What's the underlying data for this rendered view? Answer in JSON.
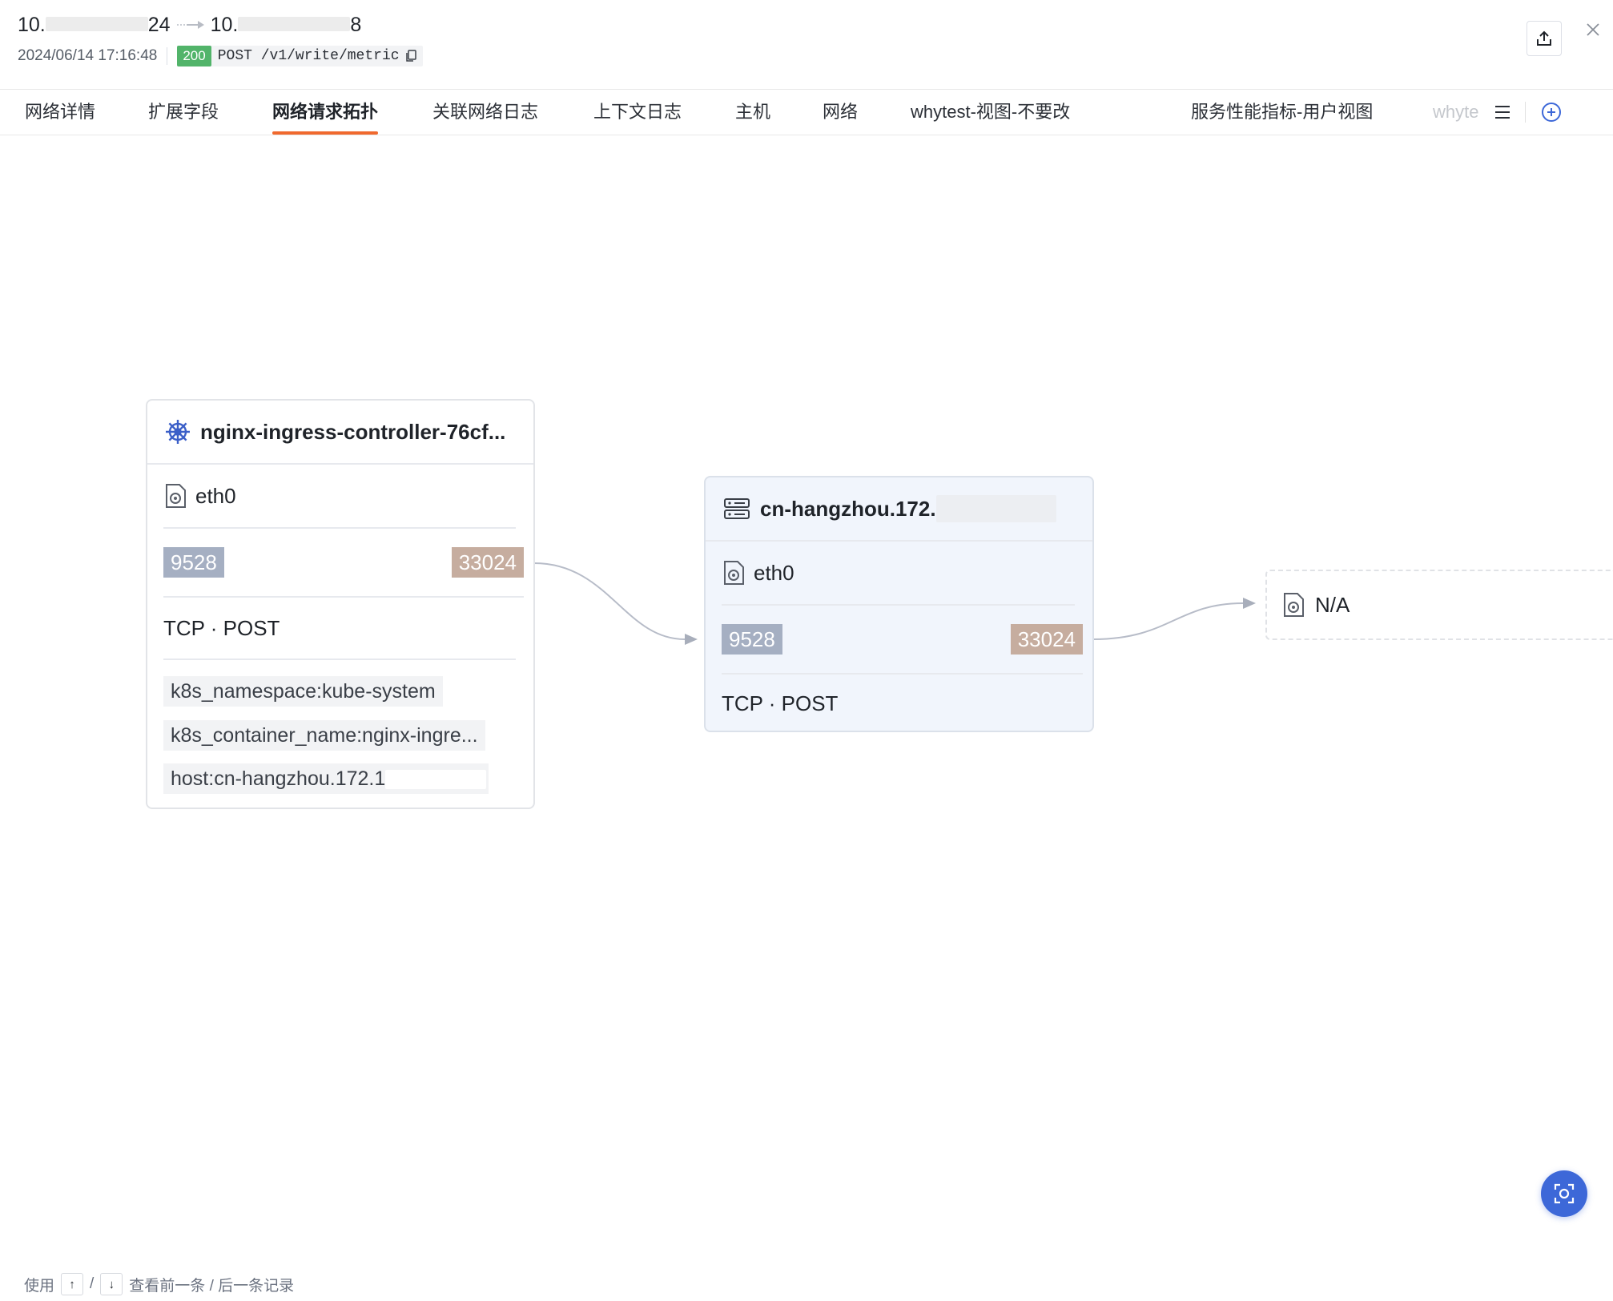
{
  "header": {
    "route_src_prefix": "10.",
    "route_src_suffix": "24",
    "route_dst_prefix": "10.",
    "route_dst_suffix": "8",
    "timestamp": "2024/06/14 17:16:48",
    "status_code": "200",
    "request_line": "POST /v1/write/metric"
  },
  "tabs": [
    {
      "label": "网络详情"
    },
    {
      "label": "扩展字段"
    },
    {
      "label": "网络请求拓扑",
      "active": true
    },
    {
      "label": "关联网络日志"
    },
    {
      "label": "上下文日志"
    },
    {
      "label": "主机"
    },
    {
      "label": "网络"
    },
    {
      "label": "whytest-视图-不要改"
    },
    {
      "label": "服务性能指标-用户视图"
    },
    {
      "label": "whyte"
    }
  ],
  "topology": {
    "node1": {
      "title": "nginx-ingress-controller-76cf...",
      "icon": "kubernetes-icon",
      "interface": "eth0",
      "src_port": "9528",
      "dst_port": "33024",
      "protocol": "TCP · POST",
      "tags": [
        "k8s_namespace:kube-system",
        "k8s_container_name:nginx-ingre...",
        "host:cn-hangzhou.172.1"
      ]
    },
    "node2": {
      "title": "cn-hangzhou.172.",
      "icon": "server-icon",
      "interface": "eth0",
      "src_port": "9528",
      "dst_port": "33024",
      "protocol": "TCP · POST"
    },
    "node3": {
      "label": "N/A",
      "icon": "network-interface-icon"
    }
  },
  "footer": {
    "prefix": "使用",
    "key_up": "↑",
    "slash": "/",
    "key_down": "↓",
    "suffix": "查看前一条 / 后一条记录"
  },
  "colors": {
    "accent_tab": "#f0692e",
    "status_ok": "#52b46a",
    "src_port": "#a5afc2",
    "dst_port": "#c6ad9f",
    "primary": "#3d68d8"
  }
}
